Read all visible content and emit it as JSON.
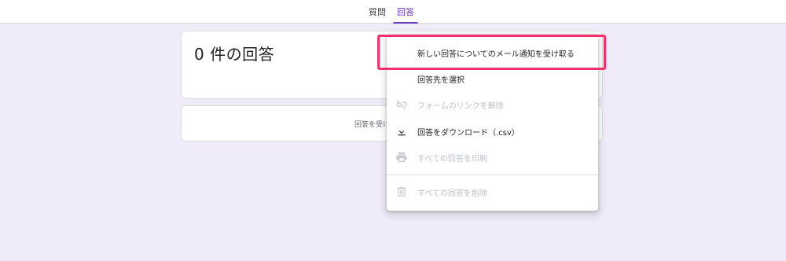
{
  "tabs": {
    "questions": "質問",
    "responses": "回答"
  },
  "summary": {
    "count_text": "0 件の回答"
  },
  "accepting": {
    "label": "回答を受け付けています"
  },
  "menu": {
    "items": [
      {
        "label": "新しい回答についてのメール通知を受け取る",
        "enabled": true,
        "icon": ""
      },
      {
        "label": "回答先を選択",
        "enabled": true,
        "icon": ""
      },
      {
        "label": "フォームのリンクを解除",
        "enabled": false,
        "icon": "link-off-icon"
      },
      {
        "label": "回答をダウンロード（.csv）",
        "enabled": true,
        "icon": "download-icon"
      },
      {
        "label": "すべての回答を印刷",
        "enabled": false,
        "icon": "print-icon"
      },
      {
        "label": "すべての回答を削除",
        "enabled": false,
        "icon": "trash-icon"
      }
    ]
  },
  "colors": {
    "accent": "#673ab7",
    "highlight": "#f0326c",
    "background": "#efebf8"
  }
}
